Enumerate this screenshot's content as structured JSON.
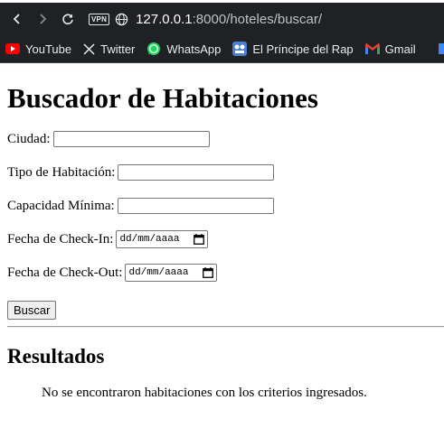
{
  "browser": {
    "vpn_label": "VPN",
    "url_host": "127.0.0.1",
    "url_rest": ":8000/hoteles/buscar/",
    "bookmarks": [
      {
        "label": "YouTube",
        "icon": "youtube-icon"
      },
      {
        "label": "Twitter",
        "icon": "x-twitter-icon"
      },
      {
        "label": "WhatsApp",
        "icon": "whatsapp-icon"
      },
      {
        "label": "El Príncipe del Rap",
        "icon": "app-bookmark-icon"
      },
      {
        "label": "Gmail",
        "icon": "gmail-icon"
      }
    ]
  },
  "page": {
    "title": "Buscador de Habitaciones",
    "fields": {
      "ciudad": {
        "label": "Ciudad:",
        "value": ""
      },
      "tipo": {
        "label": "Tipo de Habitación:",
        "value": ""
      },
      "capacidad": {
        "label": "Capacidad Mínima:",
        "value": ""
      },
      "checkin": {
        "label": "Fecha de Check-In:",
        "placeholder": "dd/mm/aaaa"
      },
      "checkout": {
        "label": "Fecha de Check-Out:",
        "placeholder": "dd/mm/aaaa"
      }
    },
    "submit_label": "Buscar",
    "results_title": "Resultados",
    "results_message": "No se encontraron habitaciones con los criterios ingresados."
  }
}
